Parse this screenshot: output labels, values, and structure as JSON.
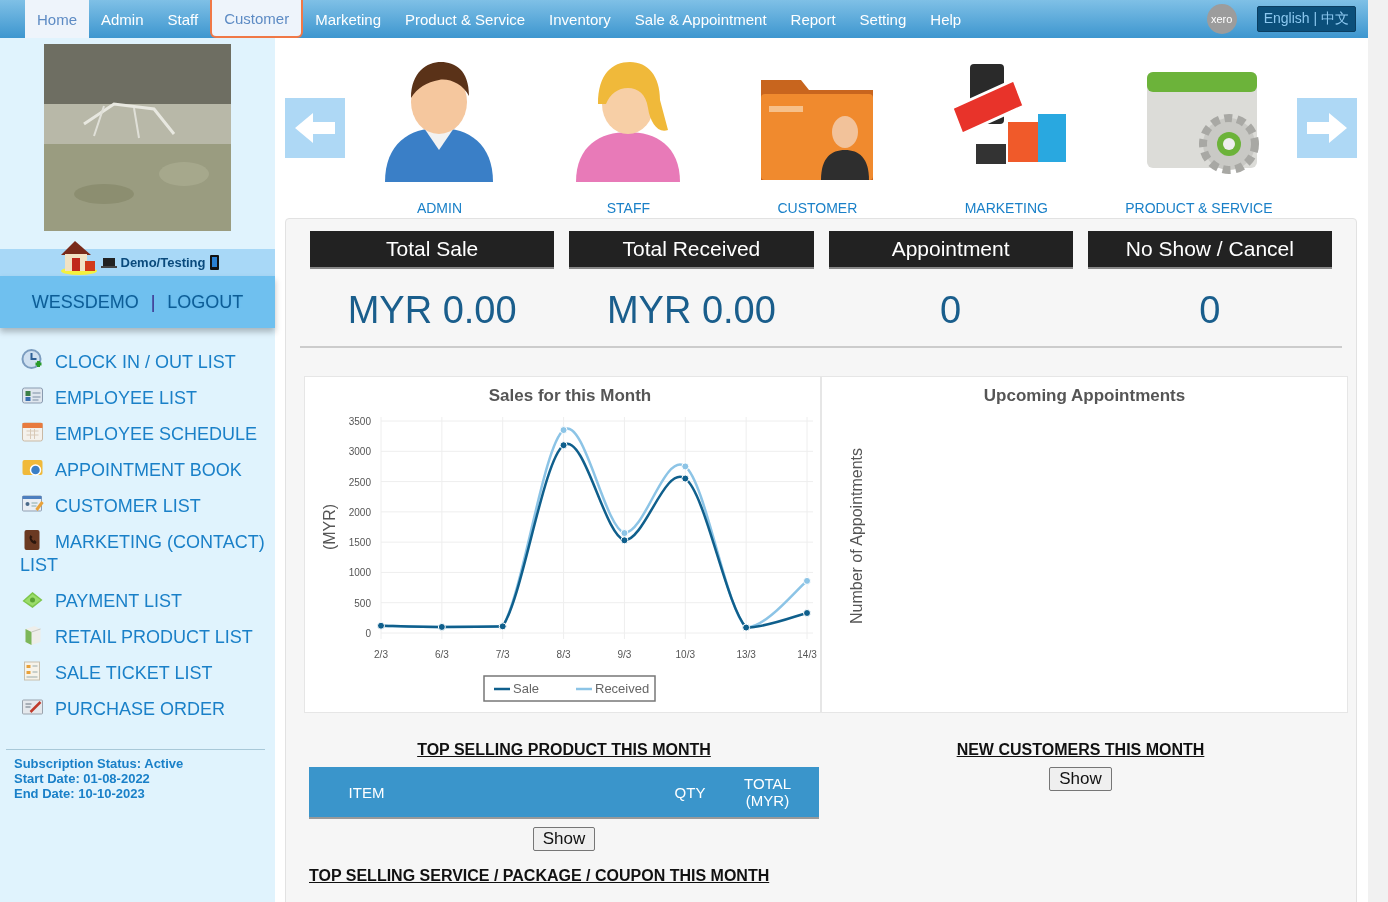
{
  "nav": {
    "items": [
      {
        "label": "Home",
        "selected": true,
        "outlined": false
      },
      {
        "label": "Admin",
        "selected": false,
        "outlined": false
      },
      {
        "label": "Staff",
        "selected": false,
        "outlined": false
      },
      {
        "label": "Customer",
        "selected": true,
        "outlined": true
      },
      {
        "label": "Marketing",
        "selected": false,
        "outlined": false
      },
      {
        "label": "Product & Service",
        "selected": false,
        "outlined": false
      },
      {
        "label": "Inventory",
        "selected": false,
        "outlined": false
      },
      {
        "label": "Sale & Appointment",
        "selected": false,
        "outlined": false
      },
      {
        "label": "Report",
        "selected": false,
        "outlined": false
      },
      {
        "label": "Setting",
        "selected": false,
        "outlined": false
      },
      {
        "label": "Help",
        "selected": false,
        "outlined": false
      }
    ],
    "xero": "xero",
    "language": {
      "label": "English | 中文",
      "selected": true
    }
  },
  "sidebar": {
    "profile": {
      "kind": "picture"
    },
    "device": "Demo/Testing",
    "user": "WESSDEMO",
    "separator": "|",
    "logout": "LOGOUT",
    "items": [
      {
        "label": "CLOCK IN / OUT LIST",
        "kind": "clock"
      },
      {
        "label": "EMPLOYEE LIST",
        "kind": "cards"
      },
      {
        "label": "EMPLOYEE SCHEDULE",
        "kind": "calendar"
      },
      {
        "label": "APPOINTMENT BOOK",
        "kind": "book"
      },
      {
        "label": "CUSTOMER LIST",
        "kind": "card"
      },
      {
        "label": "MARKETING (CONTACT) LIST",
        "kind": "contacts"
      },
      {
        "label": "PAYMENT LIST",
        "kind": "money"
      },
      {
        "label": "RETAIL PRODUCT LIST",
        "kind": "box"
      },
      {
        "label": "SALE TICKET LIST",
        "kind": "ticket"
      },
      {
        "label": "PURCHASE ORDER",
        "kind": "order"
      }
    ],
    "subscription": [
      "Subscription Status: Active",
      "Start Date: 01-08-2022",
      "End Date: 10-10-2023"
    ]
  },
  "carousel": [
    {
      "label": "ADMIN",
      "kind": "man"
    },
    {
      "label": "STAFF",
      "kind": "woman"
    },
    {
      "label": "CUSTOMER",
      "kind": "folder"
    },
    {
      "label": "MARKETING",
      "kind": "open"
    },
    {
      "label": "PRODUCT & SERVICE",
      "kind": "gear"
    }
  ],
  "stats": [
    {
      "title": "Total Sale",
      "value": "MYR 0.00"
    },
    {
      "title": "Total Received",
      "value": "MYR 0.00"
    },
    {
      "title": "Appointment",
      "value": "0"
    },
    {
      "title": "No Show / Cancel",
      "value": "0"
    }
  ],
  "sales_chart": {
    "chart_data": {
      "type": "line",
      "title": "Sales for this Month",
      "ylabel": "(MYR)",
      "categories": [
        "2/3",
        "6/3",
        "7/3",
        "8/3",
        "9/3",
        "10/3",
        "13/3",
        "14/3"
      ],
      "series": [
        {
          "name": "Sale",
          "color": "#0f5f8c",
          "marker": "circle",
          "values": [
            120,
            100,
            110,
            3100,
            1530,
            2550,
            90,
            330
          ]
        },
        {
          "name": "Received",
          "color": "#8cc4e6",
          "marker": "circle",
          "values": [
            120,
            100,
            110,
            3350,
            1650,
            2750,
            90,
            860
          ]
        }
      ],
      "grid": true,
      "legend": true,
      "ylim": [
        0,
        3500
      ],
      "yticks": [
        0,
        500,
        1000,
        1500,
        2000,
        2500,
        3000,
        3500
      ]
    }
  },
  "appointments": {
    "title": "Upcoming Appointments",
    "ylabel": "Number of Appointments"
  },
  "top_products": {
    "title": "TOP SELLING PRODUCT THIS MONTH",
    "columns": [
      "ITEM",
      "QTY",
      "TOTAL (MYR)"
    ],
    "button": "Show"
  },
  "new_customers": {
    "title": "NEW CUSTOMERS THIS MONTH",
    "button": "Show"
  },
  "top_services": {
    "title": "TOP SELLING SERVICE / PACKAGE / COUPON THIS MONTH"
  }
}
